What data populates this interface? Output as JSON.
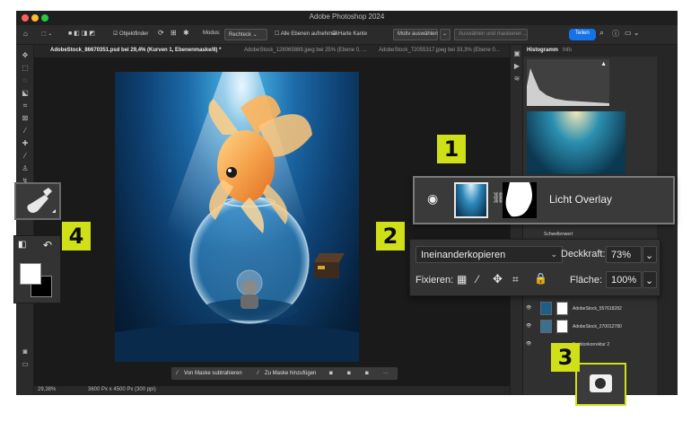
{
  "window": {
    "title": "Adobe Photoshop 2024"
  },
  "options_bar": {
    "objektfinder": "Objektfinder",
    "modus_label": "Modus:",
    "modus_value": "Rechteck",
    "alle_ebenen": "Alle Ebenen aufnehmen",
    "harte_kante": "Harte Kante",
    "motiv": "Motiv auswählen",
    "auswaehlen": "Auswählen und maskieren ...",
    "teilen": "Teilen"
  },
  "tabs": [
    {
      "label": "AdobeStock_86670351.psd bei 29,4% (Kurven 1, Ebenenmaske/8) *"
    },
    {
      "label": "AdobeStock_128065889.jpeg bei 25% (Ebene 0, ..."
    },
    {
      "label": "AdobeStock_72055317.jpeg bei 33,3% (Ebene 0..."
    }
  ],
  "panel_tabs": {
    "histogramm": "Histogramm",
    "info": "Info"
  },
  "status": {
    "zoom": "29,38%",
    "dimensions": "3600 Px x 4500 Px (300 ppi)"
  },
  "contextual_taskbar": {
    "subtract": "Von Maske subtrahieren",
    "add": "Zu Maske hinzufügen",
    "more": "···"
  },
  "layer_callout": {
    "name": "Licht Overlay"
  },
  "blend_callout": {
    "mode": "Ineinanderkopieren",
    "opacity_label": "Deckkraft:",
    "opacity_value": "73%",
    "lock_label": "Fixieren:",
    "fill_label": "Fläche:",
    "fill_value": "100%"
  },
  "layers": [
    {
      "name": "Schwellenwert"
    },
    {
      "name": "AdobeStock_557618282"
    },
    {
      "name": "AdobeStock_270012780"
    },
    {
      "name": "Farbtonkorrektur 2"
    }
  ],
  "badges": [
    "1",
    "2",
    "3",
    "4"
  ],
  "colors": {
    "accent_badge": "#cfe019",
    "share_button": "#1473e6",
    "panel_bg": "#323232"
  }
}
